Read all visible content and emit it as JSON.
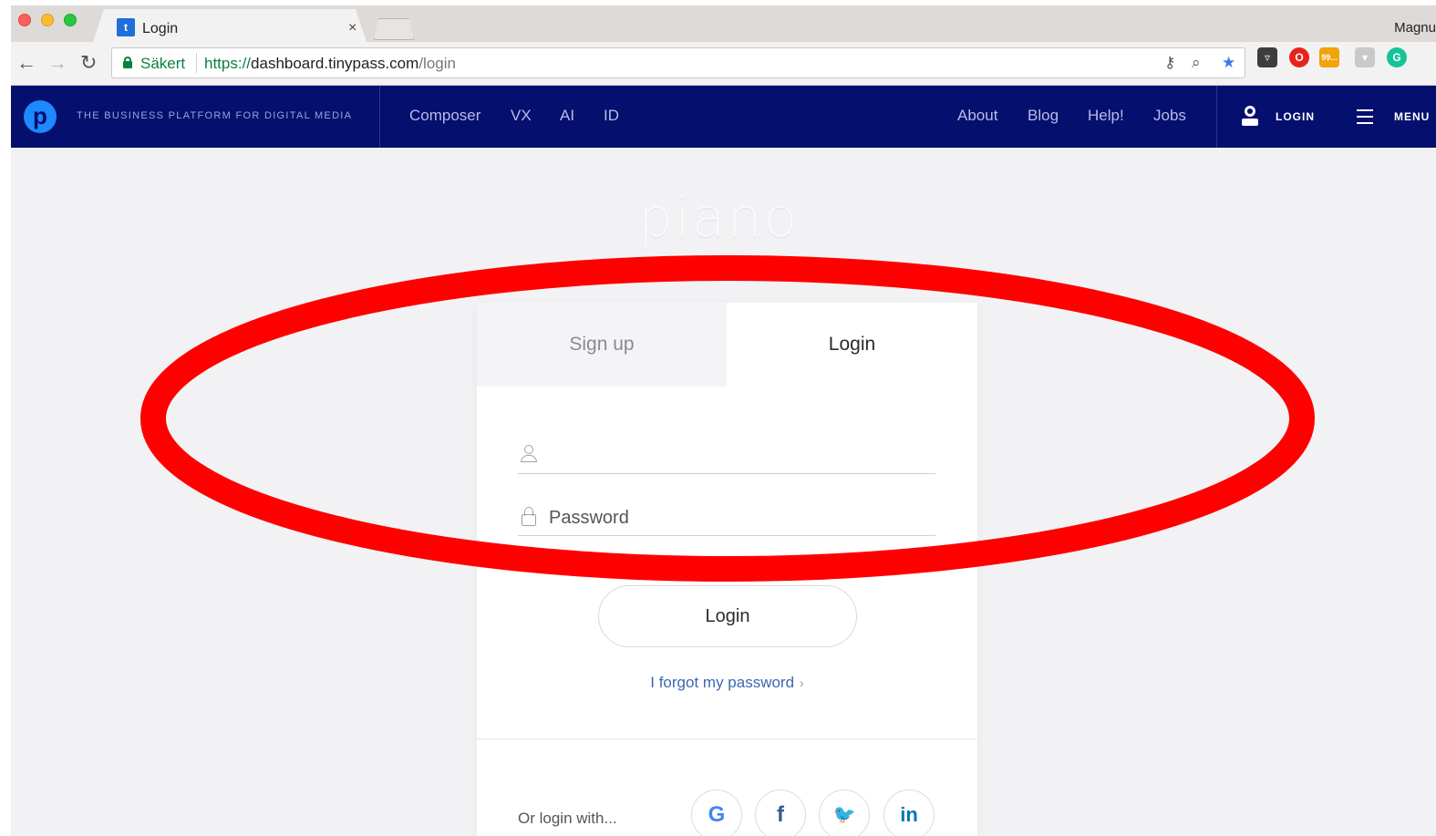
{
  "browser": {
    "tab_title": "Login",
    "tab_favicon": "t",
    "tab_close": "×",
    "profile_name": "Magnu",
    "secure_label": "Säkert",
    "url_scheme": "https://",
    "url_host": "dashboard.tinypass.com",
    "url_path": "/login",
    "extension_badge": "99..."
  },
  "site_nav": {
    "logo_letter": "p",
    "tagline": "THE BUSINESS PLATFORM FOR DIGITAL MEDIA",
    "products": [
      "Composer",
      "VX",
      "AI",
      "ID"
    ],
    "links": [
      "About",
      "Blog",
      "Help!",
      "Jobs"
    ],
    "login_label": "LOGIN",
    "menu_label": "MENU"
  },
  "page": {
    "wordmark": "piano",
    "tabs": {
      "signup": "Sign up",
      "login": "Login"
    },
    "username_field": {
      "value": "",
      "placeholder": ""
    },
    "password_field": {
      "value": "",
      "placeholder": "Password"
    },
    "login_button": "Login",
    "forgot_link": "I forgot my password",
    "forgot_chevron": "›",
    "social_prompt": "Or login with...",
    "social_buttons": [
      {
        "icon": "google-icon",
        "glyph": "G",
        "color": "#4285f4"
      },
      {
        "icon": "facebook-icon",
        "glyph": "f",
        "color": "#3b5998"
      },
      {
        "icon": "twitter-icon",
        "glyph": "🐦",
        "color": "#1da1f2"
      },
      {
        "icon": "linkedin-icon",
        "glyph": "in",
        "color": "#0077b5"
      }
    ]
  },
  "colors": {
    "nav_background": "#050f6e",
    "annotation_ellipse": "#ff0000",
    "secure_green": "#0b8043",
    "link_blue": "#3a68b3"
  },
  "annotation": {
    "shape": "ellipse",
    "color": "#ff0000"
  }
}
